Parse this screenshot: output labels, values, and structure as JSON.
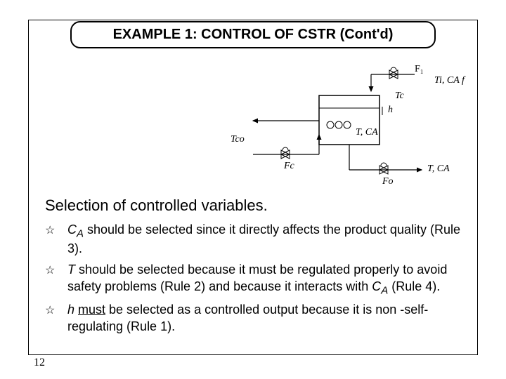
{
  "title": "EXAMPLE 1: CONTROL OF CSTR (Cont'd)",
  "diagram": {
    "F1": "F₁",
    "Ti_CAf": "Ti,  CA f",
    "Tc": "Tc",
    "h": "h",
    "Tco": "Tco",
    "Fc": "Fc",
    "T_CA": "T, CA",
    "Fo": "Fo",
    "T_CA2": "T, CA"
  },
  "heading": "Selection of controlled variables.",
  "bullets": {
    "b1": {
      "ca": "C",
      "ca_sub": "A",
      "text": " should be selected since it directly affects the product quality (Rule 3)."
    },
    "b2": {
      "t": "T ",
      "text1": " should be selected because it must be regulated properly to avoid safety problems (Rule 2) and because it interacts with ",
      "ca": "C",
      "ca_sub": "A",
      "text2": " (Rule 4)."
    },
    "b3": {
      "h": "h ",
      "must": "must",
      "text": " be selected as a controlled output because it is non -self-regulating (Rule 1)."
    }
  },
  "pageNumber": "12"
}
